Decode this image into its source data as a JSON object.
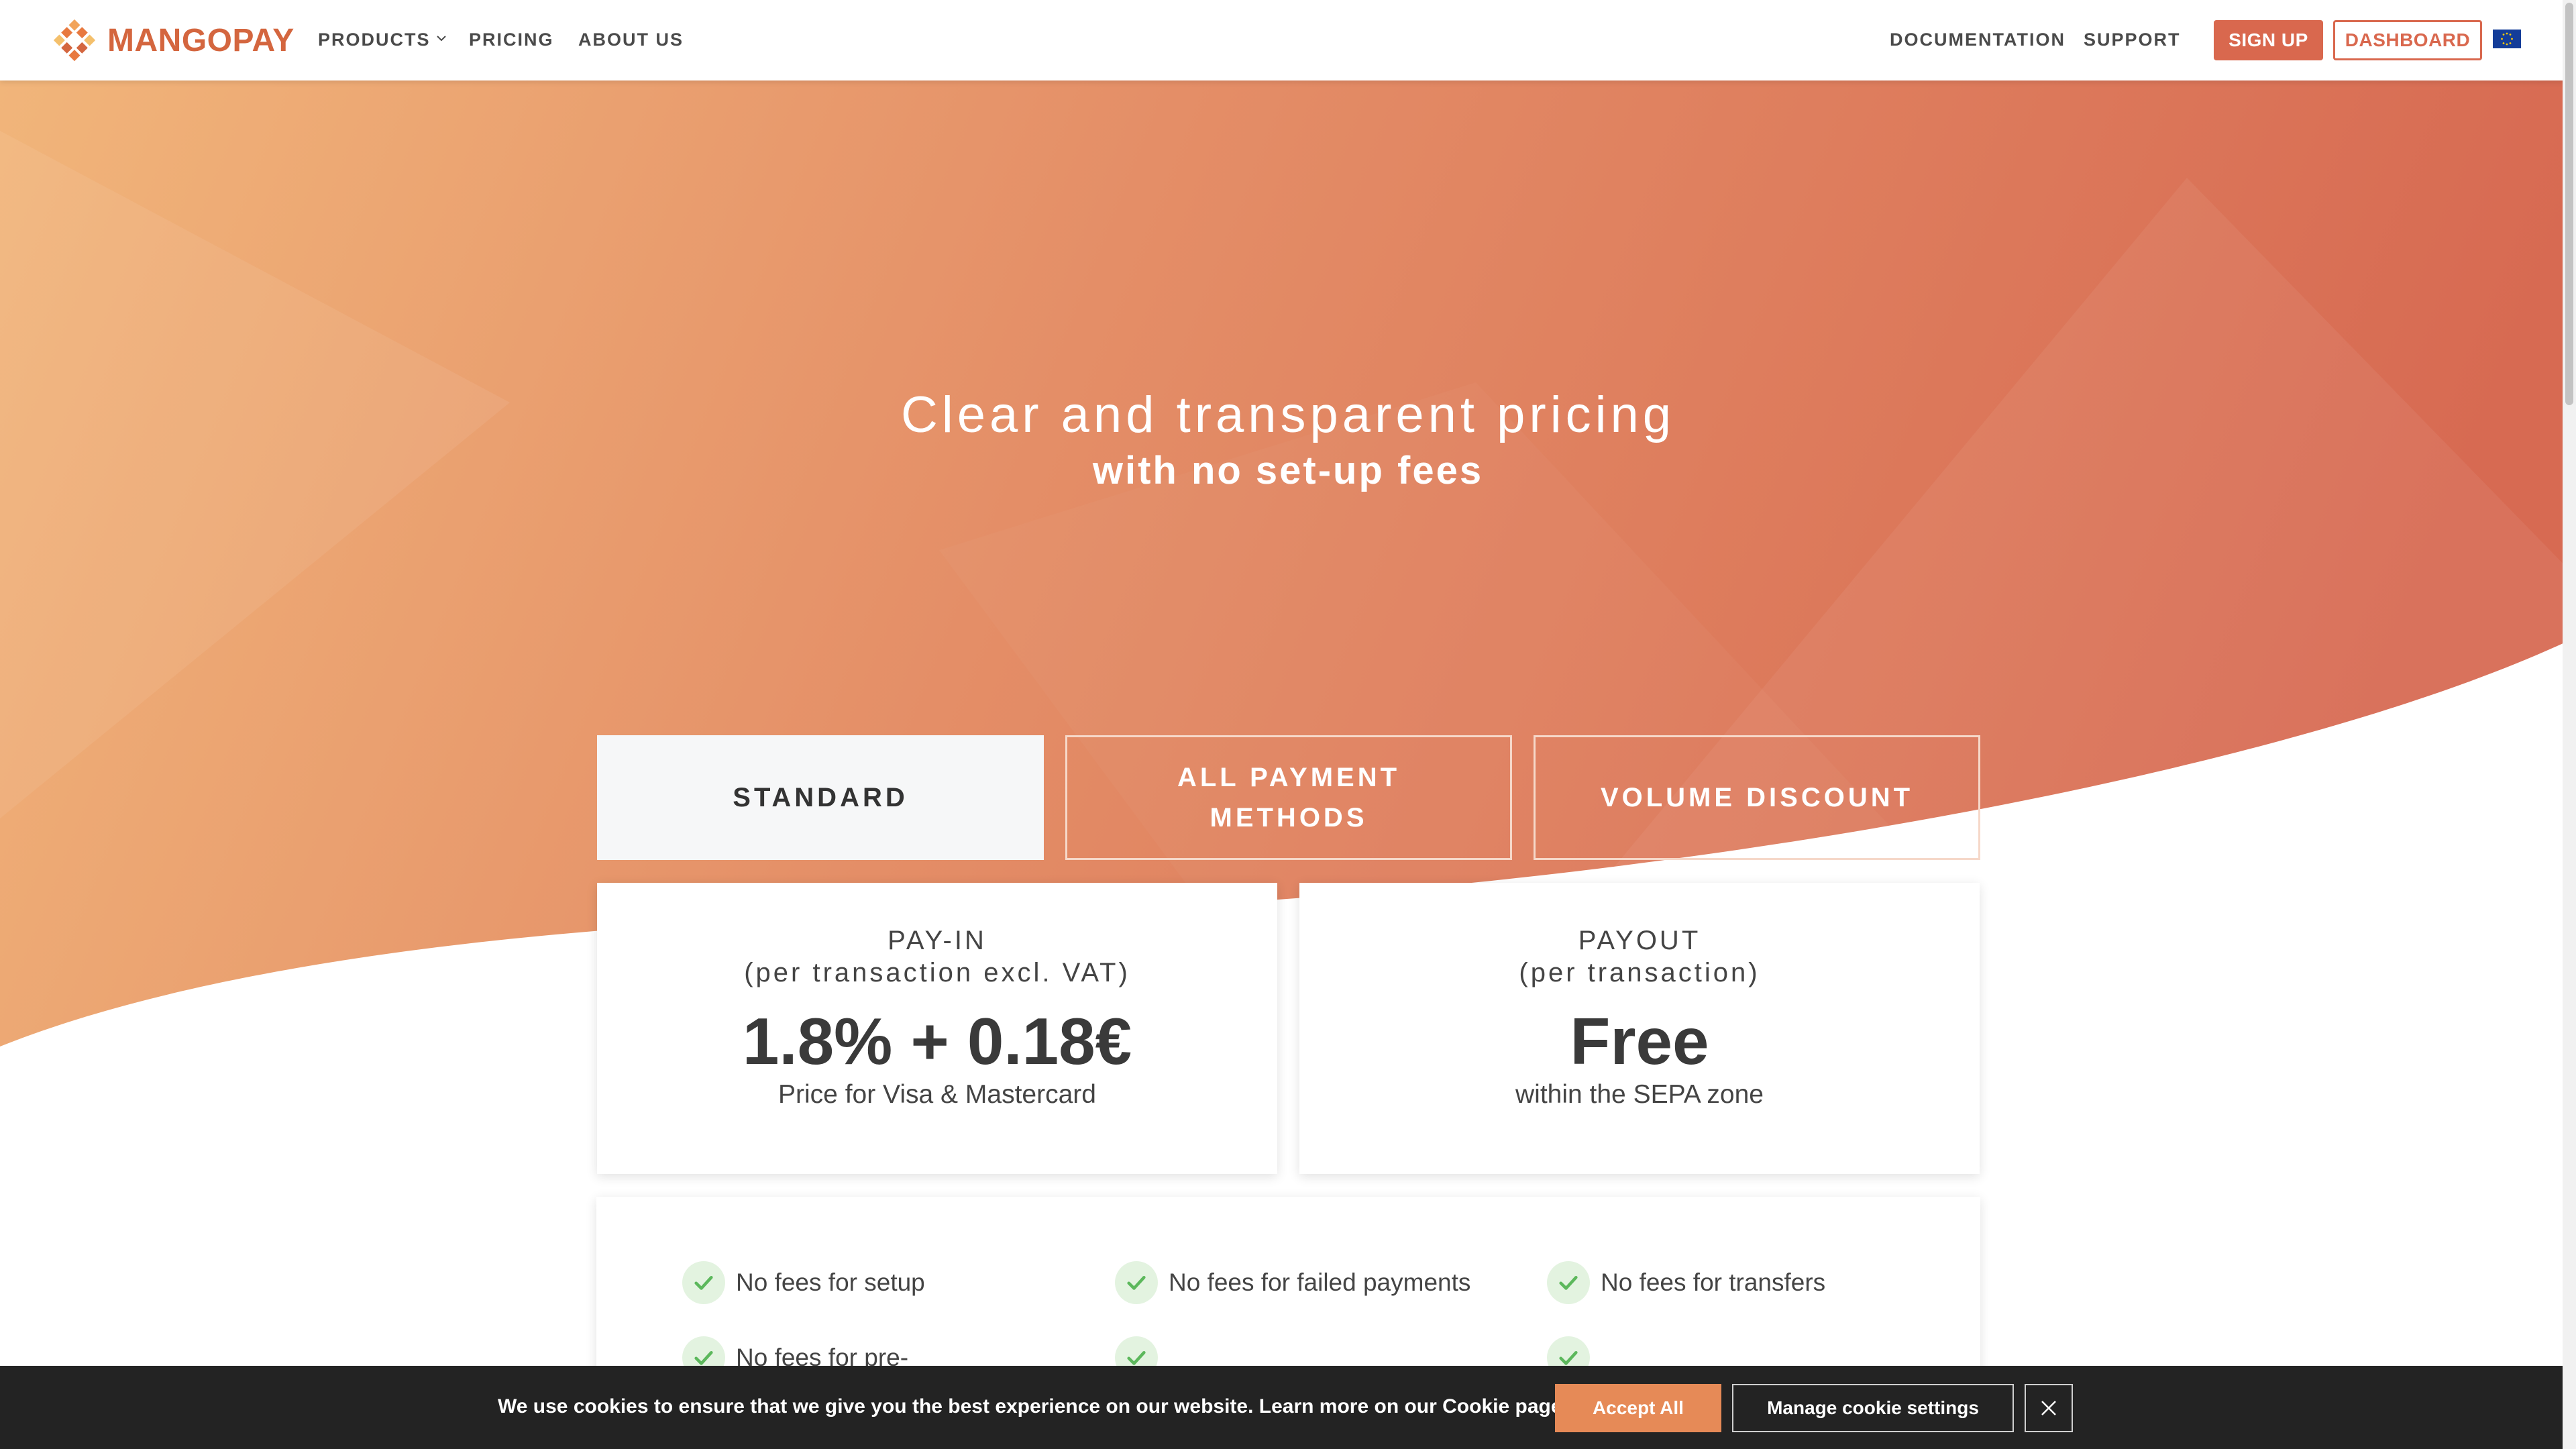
{
  "nav": {
    "brand": "MANGOPAY",
    "products": "PRODUCTS",
    "pricing": "PRICING",
    "about": "ABOUT US",
    "documentation": "DOCUMENTATION",
    "support": "SUPPORT",
    "signup": "SIGN UP",
    "dashboard": "DASHBOARD",
    "language_icon": "eu-flag-icon"
  },
  "hero": {
    "title": "Clear and transparent pricing",
    "subtitle": "with no set-up fees"
  },
  "tabs": [
    {
      "label": "STANDARD",
      "active": true
    },
    {
      "label": "ALL PAYMENT METHODS",
      "active": false
    },
    {
      "label": "VOLUME DISCOUNT",
      "active": false
    }
  ],
  "payin": {
    "title": "PAY-IN",
    "subtitle": "(per transaction excl. VAT)",
    "price": "1.8% + 0.18€",
    "desc": "Price for Visa & Mastercard"
  },
  "payout": {
    "title": "PAYOUT",
    "subtitle": "(per transaction)",
    "price": "Free",
    "desc": "within the SEPA zone"
  },
  "features": [
    "No fees for setup",
    "No fees for failed payments",
    "No fees for transfers",
    "No fees for pre-"
  ],
  "cookie": {
    "text": "We use cookies to ensure that we give you the best experience on our website. Learn more on our Cookie page.",
    "accept": "Accept All",
    "manage": "Manage cookie settings"
  },
  "colors": {
    "accent": "#d9684e",
    "hero_start": "#f1b57a",
    "hero_end": "#d76a52",
    "cookie_bg": "#232323",
    "accept_bg": "#e68a57",
    "check_green": "#5cb85c"
  }
}
